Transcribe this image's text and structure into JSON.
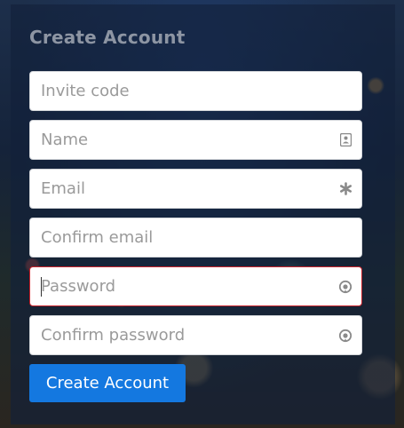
{
  "form": {
    "title": "Create Account",
    "fields": [
      {
        "placeholder": "Invite code",
        "value": "",
        "icon": ""
      },
      {
        "placeholder": "Name",
        "value": "",
        "icon": "contact-card-icon"
      },
      {
        "placeholder": "Email",
        "value": "",
        "icon": "required-asterisk-icon"
      },
      {
        "placeholder": "Confirm email",
        "value": "",
        "icon": ""
      },
      {
        "placeholder": "Password",
        "value": "",
        "icon": "password-reveal-icon",
        "state": "error"
      },
      {
        "placeholder": "Confirm password",
        "value": "",
        "icon": "password-reveal-icon"
      }
    ],
    "submit_label": "Create Account"
  },
  "colors": {
    "accent": "#1478e0",
    "error_border": "#c8232c",
    "title": "#8d95a3"
  }
}
